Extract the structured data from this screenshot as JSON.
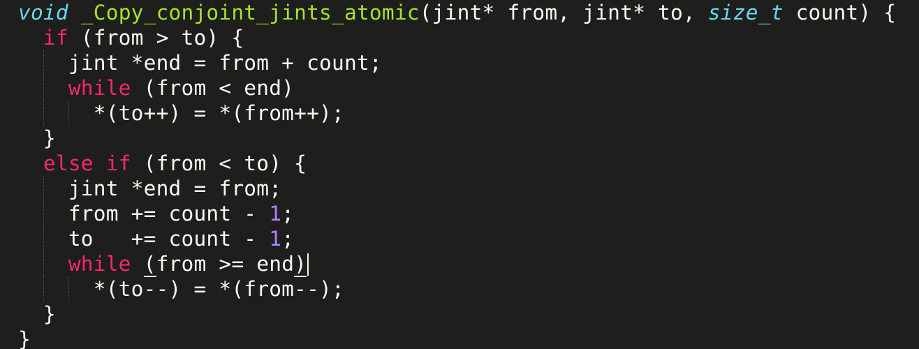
{
  "editor": {
    "language": "C++",
    "theme": "Monokai",
    "colors": {
      "background": "#1e1e1c",
      "text": "#f8f8f2",
      "keyword": "#f92672",
      "function": "#a6e22e",
      "type": "#66d9ef",
      "number": "#ae81ff"
    },
    "lines": [
      {
        "indent": 0,
        "tokens": [
          {
            "t": "type-italic",
            "v": "void"
          },
          {
            "t": "plain",
            "v": " "
          },
          {
            "t": "fn",
            "v": "_Copy_conjoint_jints_atomic"
          },
          {
            "t": "plain",
            "v": "(jint* from, jint* to, "
          },
          {
            "t": "type-italic",
            "v": "size_t"
          },
          {
            "t": "plain",
            "v": " count) {"
          }
        ]
      },
      {
        "indent": 1,
        "tokens": [
          {
            "t": "kw",
            "v": "if"
          },
          {
            "t": "plain",
            "v": " (from > to) {"
          }
        ]
      },
      {
        "indent": 2,
        "tokens": [
          {
            "t": "plain",
            "v": "jint *end = from + count;"
          }
        ]
      },
      {
        "indent": 2,
        "tokens": [
          {
            "t": "kw",
            "v": "while"
          },
          {
            "t": "plain",
            "v": " (from < end)"
          }
        ]
      },
      {
        "indent": 3,
        "tokens": [
          {
            "t": "plain",
            "v": "*(to++) = *(from++);"
          }
        ]
      },
      {
        "indent": 1,
        "tokens": [
          {
            "t": "plain",
            "v": "}"
          }
        ]
      },
      {
        "indent": 1,
        "tokens": [
          {
            "t": "kw",
            "v": "else if"
          },
          {
            "t": "plain",
            "v": " (from < to) {"
          }
        ]
      },
      {
        "indent": 2,
        "tokens": [
          {
            "t": "plain",
            "v": "jint *end = from;"
          }
        ]
      },
      {
        "indent": 2,
        "tokens": [
          {
            "t": "plain",
            "v": "from += count - "
          },
          {
            "t": "num",
            "v": "1"
          },
          {
            "t": "plain",
            "v": ";"
          }
        ]
      },
      {
        "indent": 2,
        "tokens": [
          {
            "t": "plain",
            "v": "to   += count - "
          },
          {
            "t": "num",
            "v": "1"
          },
          {
            "t": "plain",
            "v": ";"
          }
        ]
      },
      {
        "indent": 2,
        "tokens": [
          {
            "t": "kw",
            "v": "while"
          },
          {
            "t": "plain",
            "v": " "
          },
          {
            "t": "match",
            "v": "("
          },
          {
            "t": "plain",
            "v": "from >= end"
          },
          {
            "t": "match",
            "v": ")"
          },
          {
            "t": "caret",
            "v": ""
          }
        ]
      },
      {
        "indent": 3,
        "tokens": [
          {
            "t": "plain",
            "v": "*(to--) = *(from--);"
          }
        ]
      },
      {
        "indent": 1,
        "tokens": [
          {
            "t": "plain",
            "v": "}"
          }
        ]
      },
      {
        "indent": 0,
        "tokens": [
          {
            "t": "plain",
            "v": "}"
          }
        ]
      }
    ]
  }
}
